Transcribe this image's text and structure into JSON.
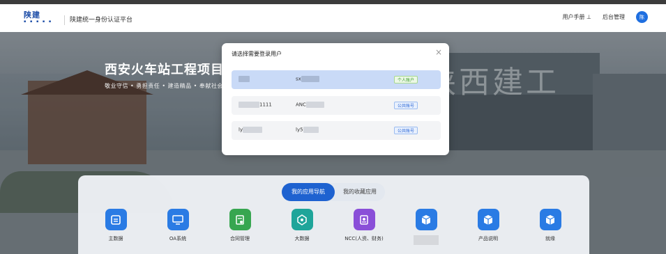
{
  "header": {
    "logo_text": "陕建",
    "logo_sub": "▪ ▪ ▪ ▪ ▪",
    "app_title": "陕建统一身份认证平台",
    "user_manual": "用户手册",
    "user_manual_icon": "⊥",
    "admin": "后台管理",
    "avatar_text": "陈"
  },
  "banner": {
    "title": "西安火车站工程项目",
    "subtitle": "敬业守信 • 勇担责任 • 建造精品 • 奉献社会",
    "watermark": "陕西建工"
  },
  "modal": {
    "title": "请选择需要登录用户",
    "close_icon": "×",
    "accounts": [
      {
        "name": "",
        "code": "sx",
        "type": "个人账户",
        "selected": true
      },
      {
        "name": "1111",
        "code": "ANC",
        "type": "公共账号",
        "selected": false
      },
      {
        "name": "ly",
        "code": "ly5",
        "type": "公共账号",
        "selected": false
      }
    ]
  },
  "panel": {
    "tabs": [
      {
        "label": "我的应用导航",
        "active": true
      },
      {
        "label": "我的收藏应用",
        "active": false
      }
    ],
    "apps": [
      {
        "label": "主数据",
        "icon": "database-icon",
        "color": "#2a7be4"
      },
      {
        "label": "OA系统",
        "icon": "oa-icon",
        "color": "#2a7be4"
      },
      {
        "label": "合同管理",
        "icon": "contract-icon",
        "color": "#37a650"
      },
      {
        "label": "大数据",
        "icon": "bigdata-icon",
        "color": "#1fa59a"
      },
      {
        "label": "NCC(人资、财务)",
        "icon": "ncc-icon",
        "color": "#8a4fd8"
      },
      {
        "label": "",
        "icon": "box-icon",
        "color": "#2a7be4"
      },
      {
        "label": "产品说明",
        "icon": "box-icon",
        "color": "#2a7be4"
      },
      {
        "label": "就缘",
        "icon": "box-icon",
        "color": "#2a7be4"
      }
    ]
  }
}
